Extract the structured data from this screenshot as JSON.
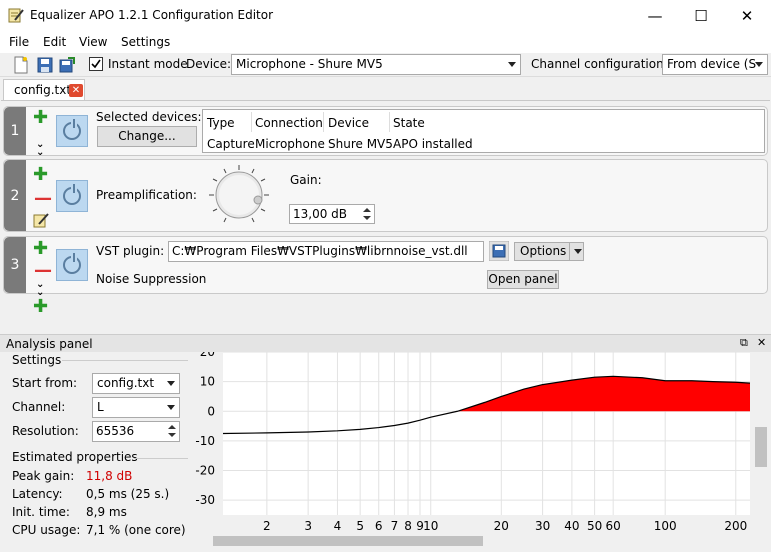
{
  "window": {
    "title": "Equalizer APO 1.2.1 Configuration Editor",
    "minimize": "—",
    "maximize": "☐",
    "close": "✕"
  },
  "menu": [
    "File",
    "Edit",
    "View",
    "Settings"
  ],
  "toolbar": {
    "instant_mode_label": "Instant mode",
    "instant_mode_checked": true,
    "device_label": "Device:",
    "device_value": "Microphone - Shure MV5",
    "channel_config_label": "Channel configuration:",
    "channel_config_value": "From device (S"
  },
  "tab": {
    "label": "config.txt"
  },
  "rows": [
    {
      "number": "1",
      "selected_devices_label": "Selected devices:",
      "change_button": "Change...",
      "table": {
        "headers": [
          "Type",
          "Connection",
          "Device",
          "State"
        ],
        "cells": [
          "Capture",
          "Microphone",
          "Shure MV5",
          "APO installed"
        ]
      }
    },
    {
      "number": "2",
      "preamp_label": "Preamplification:",
      "gain_label": "Gain:",
      "gain_value": "13,00 dB"
    },
    {
      "number": "3",
      "vst_label": "VST plugin:",
      "vst_path": "C:₩Program Files₩VSTPlugins₩librnnoise_vst.dll",
      "options_button": "Options",
      "open_panel_button": "Open panel",
      "plugin_name": "Noise Suppression"
    }
  ],
  "analysis": {
    "title": "Analysis panel",
    "settings_heading": "Settings",
    "start_from_label": "Start from:",
    "start_from_value": "config.txt",
    "channel_label": "Channel:",
    "channel_value": "L",
    "resolution_label": "Resolution:",
    "resolution_value": "65536",
    "estimated_heading": "Estimated properties",
    "peak_gain_label": "Peak gain:",
    "peak_gain_value": "11,8 dB",
    "latency_label": "Latency:",
    "latency_value": "0,5 ms (25 s.)",
    "init_time_label": "Init. time:",
    "init_time_value": "8,9 ms",
    "cpu_label": "CPU usage:",
    "cpu_value": "7,1 % (one core)"
  },
  "chart_data": {
    "type": "area",
    "x_scale": "log",
    "ylim": [
      -35,
      20
    ],
    "y_ticks": [
      "20",
      "10",
      "0",
      "-10",
      "-20",
      "-30"
    ],
    "x_ticks": [
      "2",
      "3",
      "4",
      "5",
      "6",
      "7",
      "8",
      "9",
      "10",
      "20",
      "30",
      "40",
      "50",
      "60",
      "100",
      "200"
    ],
    "x": [
      1.3,
      2,
      3,
      4,
      5,
      6,
      7,
      8,
      9,
      10,
      13,
      17,
      20,
      25,
      30,
      40,
      50,
      60,
      80,
      100,
      130,
      160,
      200,
      230
    ],
    "y": [
      -7.5,
      -7.3,
      -7,
      -6.6,
      -6.1,
      -5.5,
      -4.8,
      -4,
      -3,
      -2,
      0,
      3,
      5,
      7.5,
      9,
      10.5,
      11.5,
      11.8,
      11.3,
      10.3,
      10.3,
      10,
      9.8,
      9.5
    ],
    "fill_color": "#ff0000",
    "line_color": "#000000",
    "grid": true
  },
  "colors": {
    "peak_gain": "#d00000",
    "accent": "#bcd8f0"
  }
}
